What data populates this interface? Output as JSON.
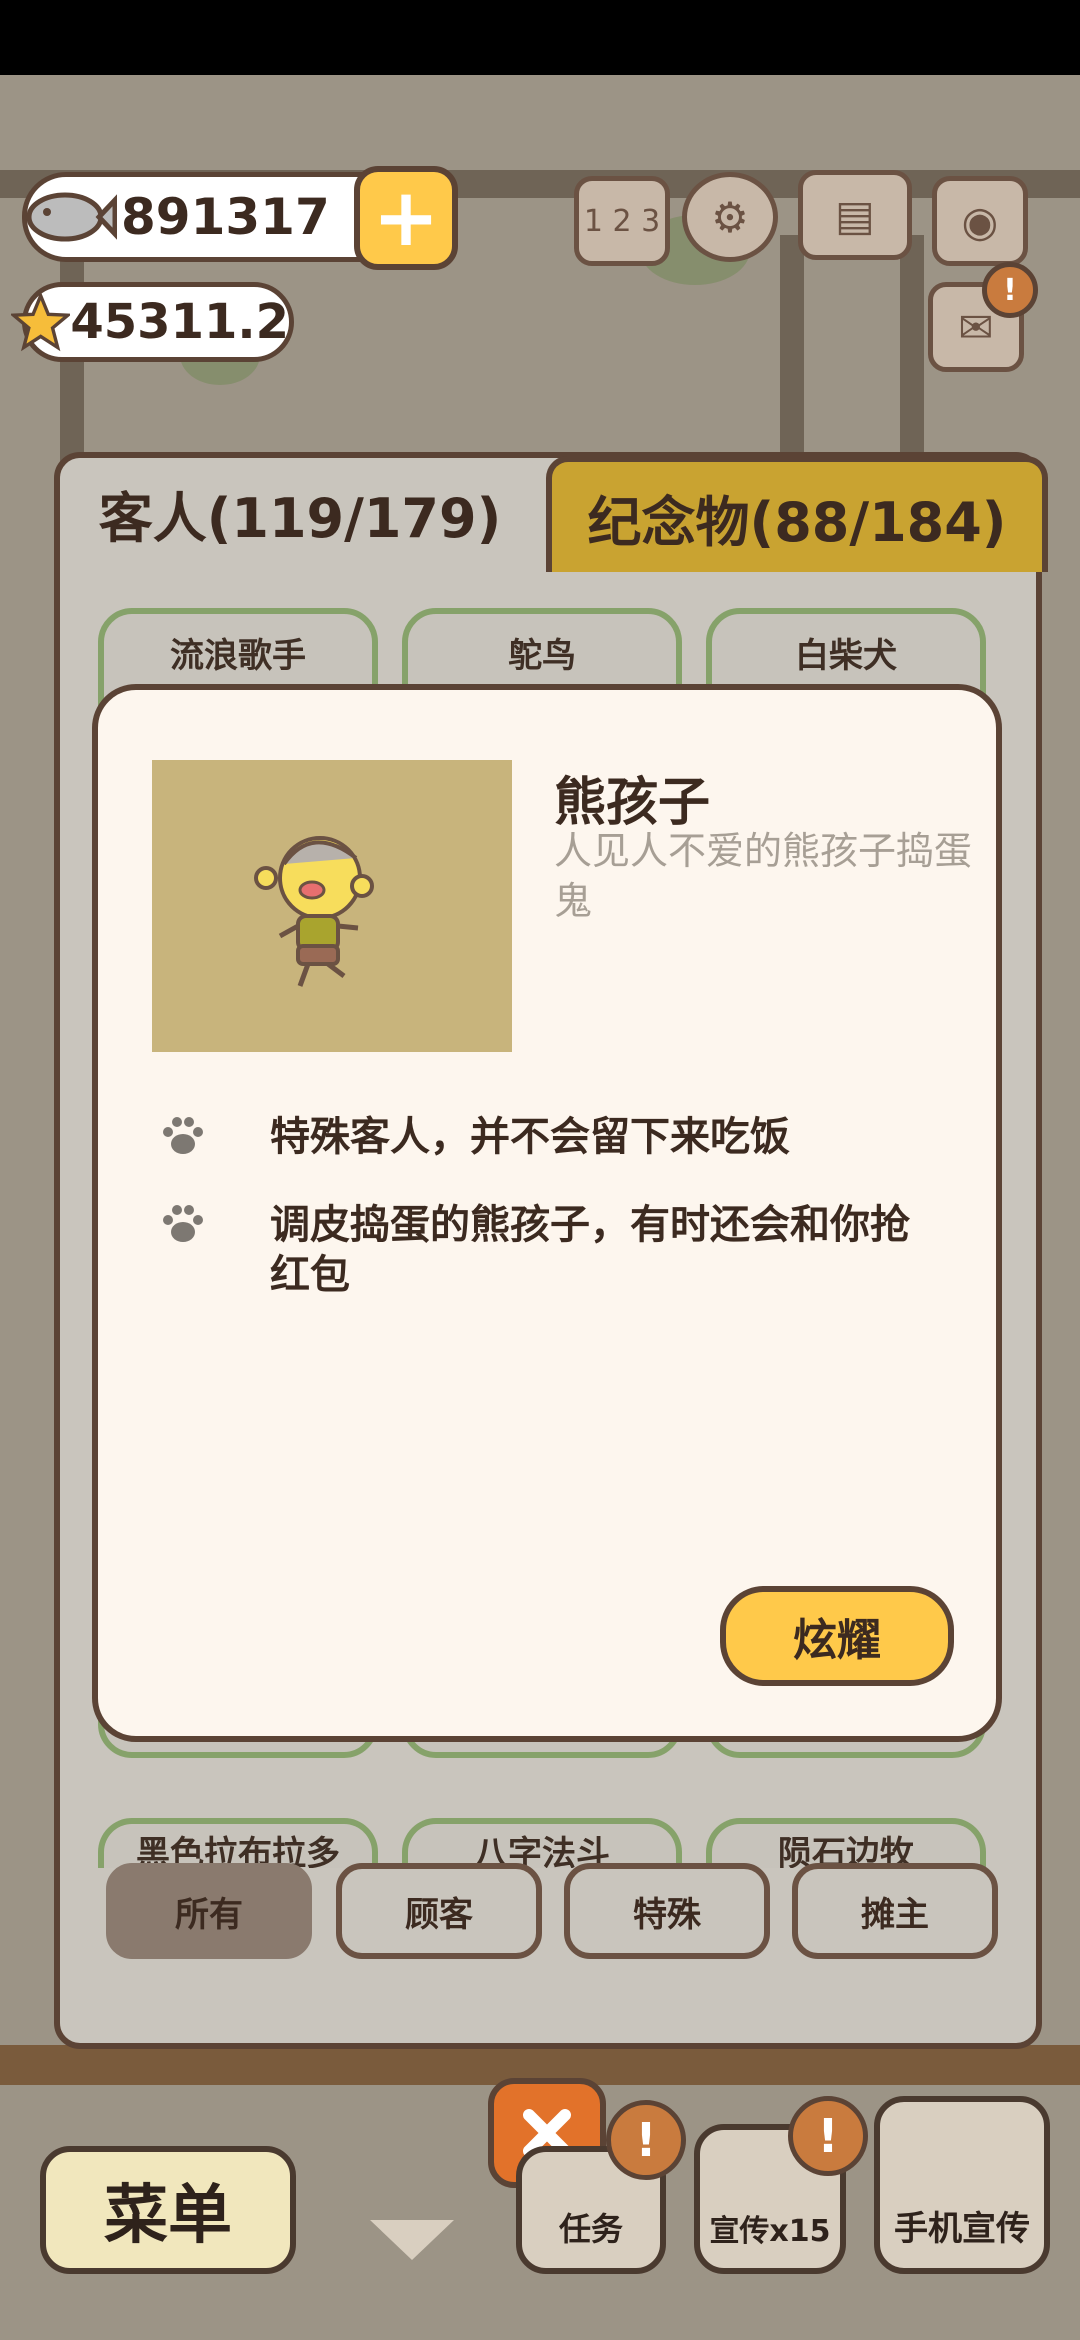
{
  "currency": {
    "fish": "891317",
    "stars": "45311.2"
  },
  "tabs": [
    {
      "label": "客人(119/179)"
    },
    {
      "label": "纪念物(88/184)"
    }
  ],
  "cards_top": [
    "流浪歌手",
    "鸵鸟",
    "白柴犬"
  ],
  "cards_bottom": [
    "黑色拉布拉多",
    "八字法斗",
    "陨石边牧"
  ],
  "filters": [
    "所有",
    "顾客",
    "特殊",
    "摊主"
  ],
  "detail": {
    "name": "熊孩子",
    "description": "人见人不爱的熊孩子捣蛋鬼",
    "bullets": [
      "特殊客人，并不会留下来吃饭",
      "调皮捣蛋的熊孩子，有时还会和你抢红包"
    ],
    "show_button": "炫耀"
  },
  "bottom": {
    "menu": "菜单",
    "tasks": "任务",
    "promote": "宣传x15",
    "phone_promote": "手机宣传"
  },
  "top_icons": {
    "plus": "+",
    "ranking": "1 2 3"
  },
  "colors": {
    "accent_yellow": "#ffc94a",
    "tab_gold": "#c9a331",
    "card_border_green": "#86a26a",
    "close_orange": "#e2722a",
    "text_dark": "#3c2a20"
  }
}
